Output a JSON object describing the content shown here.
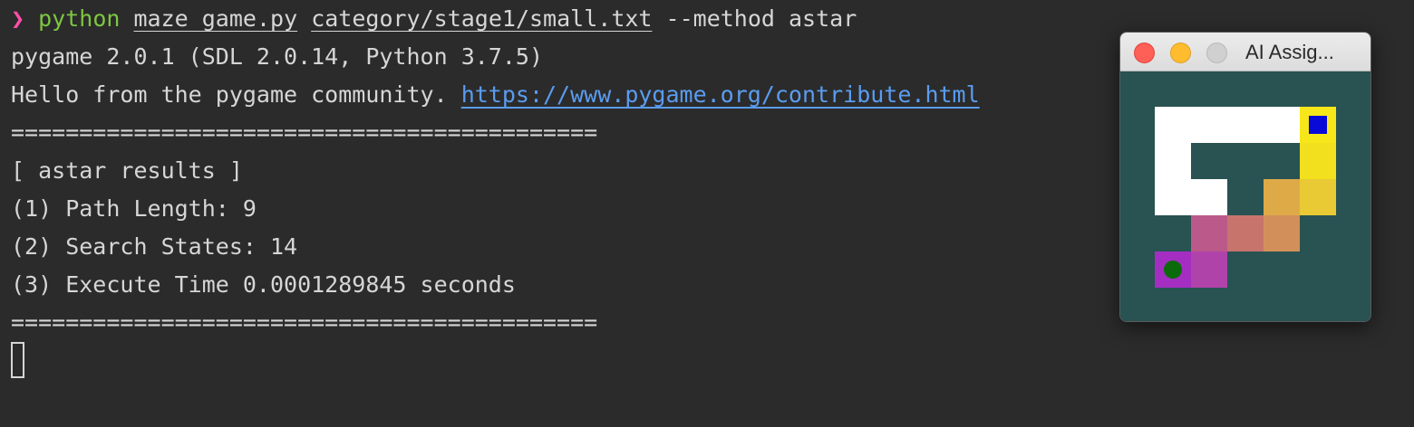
{
  "terminal": {
    "prompt_symbol": "❯",
    "command": {
      "program": "python",
      "script": "maze_game.py",
      "file_arg": "category/stage1/small.txt",
      "flags": "--method astar"
    },
    "output": {
      "pygame_version": "pygame 2.0.1 (SDL 2.0.14, Python 3.7.5)",
      "hello_text": "Hello from the pygame community.",
      "hello_link": "https://www.pygame.org/contribute.html",
      "separator": "===========================================",
      "results_header": "[ astar results ]",
      "path_length": "(1) Path Length: 9",
      "search_states": "(2) Search States: 14",
      "execute_time": "(3) Execute Time 0.0001289845 seconds",
      "separator_end": "==========================================="
    }
  },
  "game_window": {
    "title": "AI Assig...",
    "colors": {
      "background": "#285352",
      "wall": "#ffffff",
      "goal_marker": "#0a0ad8",
      "start_marker": "#0b6b0b"
    },
    "maze": {
      "grid_size": 5,
      "walls": [
        [
          0,
          0
        ],
        [
          1,
          0
        ],
        [
          2,
          0
        ],
        [
          3,
          0
        ],
        [
          0,
          1
        ],
        [
          0,
          2
        ],
        [
          1,
          2
        ]
      ],
      "path_cells": [
        {
          "col": 4,
          "row": 0,
          "color": "#f6e61a"
        },
        {
          "col": 4,
          "row": 1,
          "color": "#f2df1e"
        },
        {
          "col": 4,
          "row": 2,
          "color": "#e9c934"
        },
        {
          "col": 3,
          "row": 2,
          "color": "#deaa48"
        },
        {
          "col": 3,
          "row": 3,
          "color": "#d38f5a"
        },
        {
          "col": 2,
          "row": 3,
          "color": "#c7746d"
        },
        {
          "col": 1,
          "row": 3,
          "color": "#bb5a8a"
        },
        {
          "col": 1,
          "row": 4,
          "color": "#b043aa"
        },
        {
          "col": 0,
          "row": 4,
          "color": "#a42ec2"
        }
      ],
      "goal": {
        "col": 4,
        "row": 0
      },
      "start": {
        "col": 0,
        "row": 4
      }
    }
  }
}
